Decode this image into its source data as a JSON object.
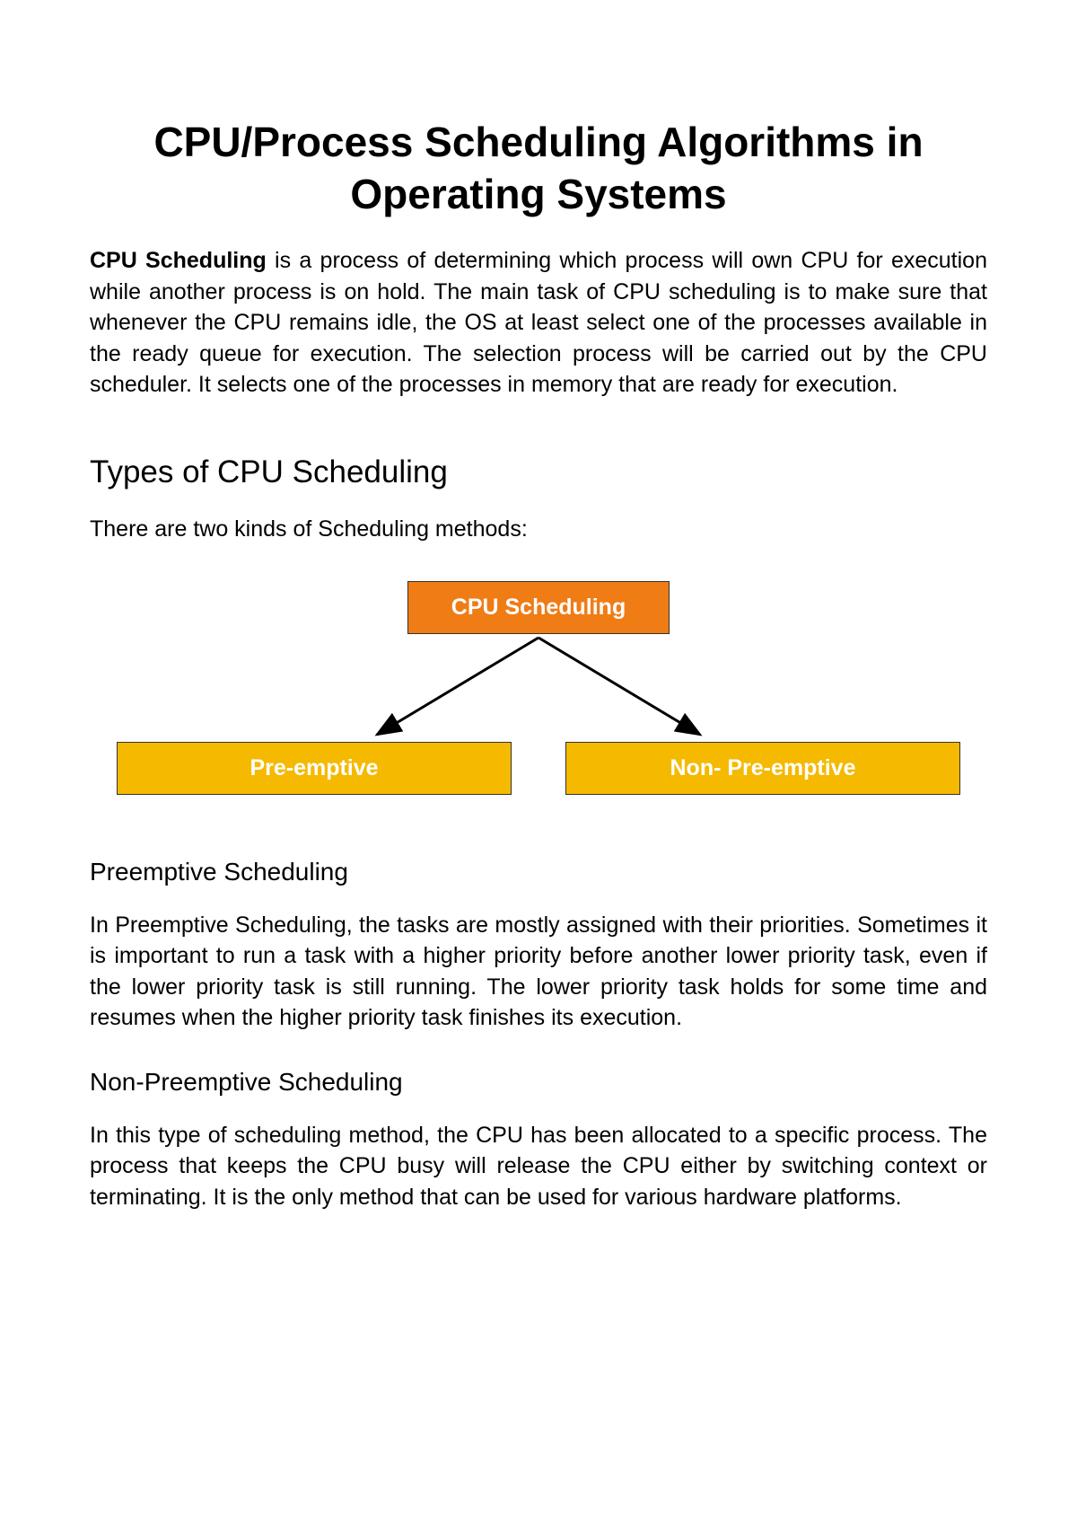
{
  "title": "CPU/Process Scheduling Algorithms in Operating Systems",
  "intro": {
    "bold": "CPU Scheduling",
    "rest": " is a process of determining which process will own CPU for execution while another process is on hold. The main task of CPU scheduling is to make sure that whenever the CPU remains idle, the OS at least select one of the processes available in the ready queue for execution. The selection process will be carried out by the CPU scheduler. It selects one of the processes in memory that are ready for execution."
  },
  "section_types": {
    "heading": "Types of CPU Scheduling",
    "subtitle": "There are two kinds of Scheduling methods:"
  },
  "diagram": {
    "top": "CPU Scheduling",
    "left": "Pre-emptive",
    "right": "Non- Pre-emptive"
  },
  "section_preemptive": {
    "heading": "Preemptive Scheduling",
    "body": "In Preemptive Scheduling, the tasks are mostly assigned with their priorities. Sometimes it is important to run a task with a higher priority before another lower priority task, even if the lower priority task is still running. The lower priority task holds for some time and resumes when the higher priority task finishes its execution."
  },
  "section_nonpreemptive": {
    "heading": "Non-Preemptive Scheduling",
    "body": "In this type of scheduling method, the CPU has been allocated to a specific process. The process that keeps the CPU busy will release the CPU either by switching context or terminating. It is the only method that can be used for various hardware platforms."
  }
}
